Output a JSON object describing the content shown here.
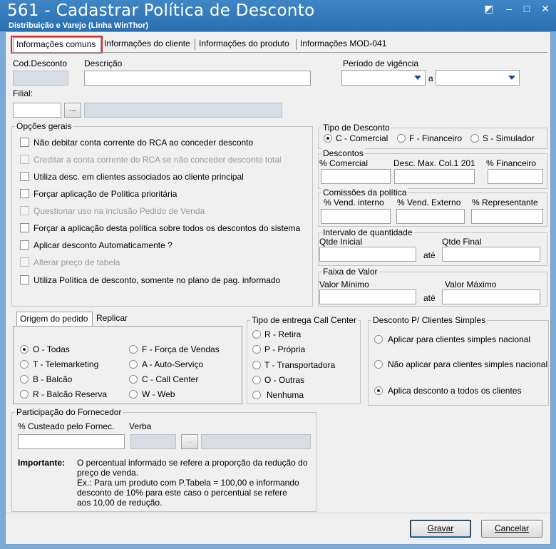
{
  "window": {
    "title": "561 - Cadastrar Política de Desconto",
    "subtitle": "Distribuição e Varejo (Linha WinThor)",
    "controls": [
      "restore-icon",
      "minimize-icon",
      "maximize-icon",
      "close-icon"
    ]
  },
  "tabs": [
    {
      "label": "Informações comuns",
      "active": true
    },
    {
      "label": "Informações do cliente"
    },
    {
      "label": "Informações do produto"
    },
    {
      "label": "Informações MOD-041"
    }
  ],
  "header": {
    "cod_label": "Cod.Desconto",
    "cod_value": "",
    "desc_label": "Descrição",
    "desc_value": "",
    "periodo_label": "Período de vigência",
    "periodo_start": "",
    "periodo_sep": "a",
    "periodo_end": "",
    "filial_label": "Filial:",
    "filial_value": "",
    "filial_btn": "...",
    "filial_name": ""
  },
  "opcoes": {
    "title": "Opções gerais",
    "items": [
      {
        "label": "Não debitar conta corrente do RCA ao conceder desconto",
        "checked": false,
        "enabled": true
      },
      {
        "label": "Creditar a conta corrente do RCA se não conceder desconto total",
        "checked": false,
        "enabled": false
      },
      {
        "label": "Utiliza desc. em clientes associados ao cliente principal",
        "checked": false,
        "enabled": true
      },
      {
        "label": "Forçar aplicação de Política prioritária",
        "checked": false,
        "enabled": true
      },
      {
        "label": "Questionar uso na inclusão Pedido de Venda",
        "checked": false,
        "enabled": false
      },
      {
        "label": "Forçar a aplicação desta política sobre todos os descontos do sistema",
        "checked": false,
        "enabled": true
      },
      {
        "label": "Aplicar desconto Automaticamente ?",
        "checked": false,
        "enabled": true
      },
      {
        "label": "Alterar preço de tabela",
        "checked": false,
        "enabled": false
      },
      {
        "label": "Utiliza Política de desconto, somente no plano de pag. informado",
        "checked": false,
        "enabled": true
      }
    ]
  },
  "tipo_desconto": {
    "title": "Tipo de Desconto",
    "options": [
      "C - Comercial",
      "F - Financeiro",
      "S - Simulador"
    ],
    "selected": "C - Comercial"
  },
  "descontos": {
    "title": "Descontos",
    "labels": [
      "% Comercial",
      "Desc. Max. Col.1 201",
      "% Financeiro"
    ]
  },
  "comissoes": {
    "title": "Comissões da política",
    "labels": [
      "% Vend. interno",
      "% Vend. Externo",
      "% Representante"
    ]
  },
  "intervalo": {
    "title": "Intervalo de quantidade",
    "min_label": "Qtde Inicial",
    "sep": "até",
    "max_label": "Qtde Final"
  },
  "faixa": {
    "title": "Faixa de Valor",
    "min_label": "Valor Mínimo",
    "sep": "até",
    "max_label": "Valor Máximo"
  },
  "origem": {
    "tabs": [
      "Origem do pedido",
      "Replicar"
    ],
    "options": [
      "O - Todas",
      "F - Força de Vendas",
      "T - Telemarketing",
      "A - Auto-Serviço",
      "B - Balcão",
      "C - Call Center",
      "R - Balcão Reserva",
      "W - Web"
    ],
    "selected": "O - Todas"
  },
  "entrega": {
    "title": "Tipo de entrega Call Center",
    "options": [
      "R - Retira",
      "P - Própria",
      "T - Transportadora",
      "O - Outras",
      "Nenhuma"
    ]
  },
  "simples": {
    "title": "Desconto P/ Clientes Simples",
    "options": [
      "Aplicar para clientes simples nacional",
      "Não aplicar para clientes simples nacional",
      "Aplica desconto a todos os clientes"
    ],
    "selected": "Aplica desconto a todos os clientes"
  },
  "fornecedor": {
    "title": "Participação do Fornecedor",
    "custeado_label": "% Custeado pelo Fornec.",
    "verba_label": "Verba",
    "verba_btn": "...",
    "importante_label": "Importante:",
    "note_lines": [
      "O percentual informado se refere a proporção da redução do",
      "preço de venda.",
      "Ex.: Para um produto com P.Tabela = 100,00 e informando",
      "desconto de 10% para este caso o percentual se refere",
      "aos 10,00 de redução."
    ]
  },
  "buttons": {
    "gravar": "Gravar",
    "cancelar": "Cancelar"
  }
}
